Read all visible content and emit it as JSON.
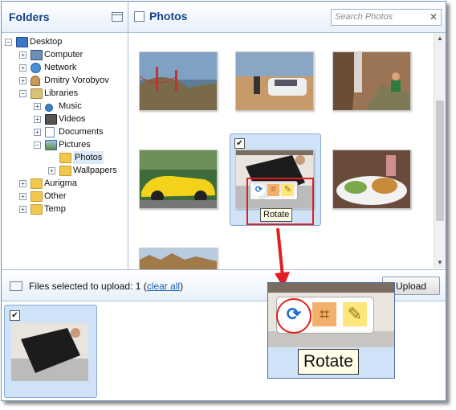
{
  "folders": {
    "title": "Folders",
    "tree": [
      {
        "label": "Desktop",
        "depth": 0,
        "expander": "minus",
        "icon": "desktop-icon"
      },
      {
        "label": "Computer",
        "depth": 1,
        "expander": "plus",
        "icon": "computer-icon"
      },
      {
        "label": "Network",
        "depth": 1,
        "expander": "plus",
        "icon": "network-icon"
      },
      {
        "label": "Dmitry Vorobyov",
        "depth": 1,
        "expander": "plus",
        "icon": "user-folder-icon"
      },
      {
        "label": "Libraries",
        "depth": 1,
        "expander": "minus",
        "icon": "libraries-icon"
      },
      {
        "label": "Music",
        "depth": 2,
        "expander": "plus",
        "icon": "music-icon"
      },
      {
        "label": "Videos",
        "depth": 2,
        "expander": "plus",
        "icon": "videos-icon"
      },
      {
        "label": "Documents",
        "depth": 2,
        "expander": "plus",
        "icon": "documents-icon"
      },
      {
        "label": "Pictures",
        "depth": 2,
        "expander": "minus",
        "icon": "pictures-icon"
      },
      {
        "label": "Photos",
        "depth": 3,
        "expander": "none",
        "icon": "folder-icon",
        "selected": true
      },
      {
        "label": "Wallpapers",
        "depth": 3,
        "expander": "plus",
        "icon": "folder-icon"
      },
      {
        "label": "Aurigma",
        "depth": 1,
        "expander": "plus",
        "icon": "folder-icon"
      },
      {
        "label": "Other",
        "depth": 1,
        "expander": "plus",
        "icon": "folder-icon"
      },
      {
        "label": "Temp",
        "depth": 1,
        "expander": "plus",
        "icon": "folder-icon"
      }
    ]
  },
  "photos": {
    "title": "Photos",
    "search_placeholder": "Search Photos",
    "clear_glyph": "✕",
    "checked_glyph": "✔",
    "tooltip": "Rotate",
    "thumbnails": [
      "golden-gate-bridge",
      "car-in-desert",
      "canyon-with-person",
      "yellow-convertible",
      "person-in-coat",
      "burger-meal",
      "tree-line"
    ]
  },
  "bottom": {
    "prefix": "Files selected to upload: 1 (",
    "clear_all": "clear all",
    "suffix": ")",
    "upload_label": "Upload"
  },
  "zoom": {
    "tooltip": "Rotate"
  },
  "colors": {
    "accent": "#15428b",
    "selection": "#cfe2f8",
    "highlight": "#e02020"
  }
}
